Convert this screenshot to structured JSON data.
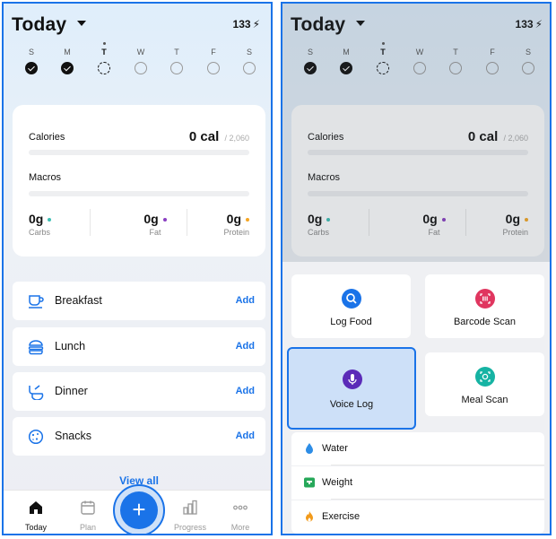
{
  "left": {
    "header": {
      "title": "Today",
      "streak": "133"
    },
    "week": [
      {
        "label": "S",
        "state": "done"
      },
      {
        "label": "M",
        "state": "done"
      },
      {
        "label": "T",
        "state": "current"
      },
      {
        "label": "W",
        "state": "empty"
      },
      {
        "label": "T",
        "state": "empty"
      },
      {
        "label": "F",
        "state": "empty"
      },
      {
        "label": "S",
        "state": "empty"
      }
    ],
    "summary": {
      "calories_label": "Calories",
      "calories_value": "0 cal",
      "calories_goal": "/ 2,060",
      "calories_progress": 0,
      "macros_label": "Macros",
      "macros_progress": 0,
      "macros": [
        {
          "value": "0g",
          "name": "Carbs",
          "color": "#3dbfb4"
        },
        {
          "value": "0g",
          "name": "Fat",
          "color": "#8a3fc2"
        },
        {
          "value": "0g",
          "name": "Protein",
          "color": "#f5a623"
        }
      ]
    },
    "meals": [
      {
        "name": "Breakfast",
        "action": "Add",
        "icon": "coffee-cup-icon"
      },
      {
        "name": "Lunch",
        "action": "Add",
        "icon": "burger-icon"
      },
      {
        "name": "Dinner",
        "action": "Add",
        "icon": "dinner-bowl-icon"
      },
      {
        "name": "Snacks",
        "action": "Add",
        "icon": "cookie-icon"
      }
    ],
    "view_all": "View all",
    "tabs": [
      {
        "label": "Today",
        "icon": "home-icon",
        "active": true
      },
      {
        "label": "Plan",
        "icon": "calendar-icon",
        "active": false
      },
      {
        "label": "Progress",
        "icon": "bar-chart-icon",
        "active": false
      },
      {
        "label": "More",
        "icon": "more-dots-icon",
        "active": false
      }
    ],
    "fab_symbol": "+"
  },
  "right": {
    "header": {
      "title": "Today",
      "streak": "133"
    },
    "summary": {
      "calories_label": "Calories",
      "calories_value": "0 cal",
      "calories_goal": "/ 2,060",
      "macros_label": "Macros",
      "macros": [
        {
          "value": "0g",
          "name": "Carbs"
        },
        {
          "value": "0g",
          "name": "Fat"
        },
        {
          "value": "0g",
          "name": "Protein"
        }
      ]
    },
    "actions": [
      {
        "label": "Log Food",
        "icon": "search-icon",
        "color": "#1a73e8",
        "selected": false
      },
      {
        "label": "Barcode Scan",
        "icon": "barcode-icon",
        "color": "#e0365f",
        "selected": false
      },
      {
        "label": "Voice Log",
        "icon": "microphone-icon",
        "color": "#5b2bb8",
        "selected": true
      },
      {
        "label": "Meal Scan",
        "icon": "camera-scan-icon",
        "color": "#16b3a3",
        "selected": false
      }
    ],
    "rows": [
      {
        "label": "Water",
        "icon": "water-drop-icon"
      },
      {
        "label": "Weight",
        "icon": "scale-icon"
      },
      {
        "label": "Exercise",
        "icon": "flame-icon"
      }
    ]
  },
  "colors": {
    "accent": "#1a73e8",
    "selection_fill": "#cde0f8"
  }
}
